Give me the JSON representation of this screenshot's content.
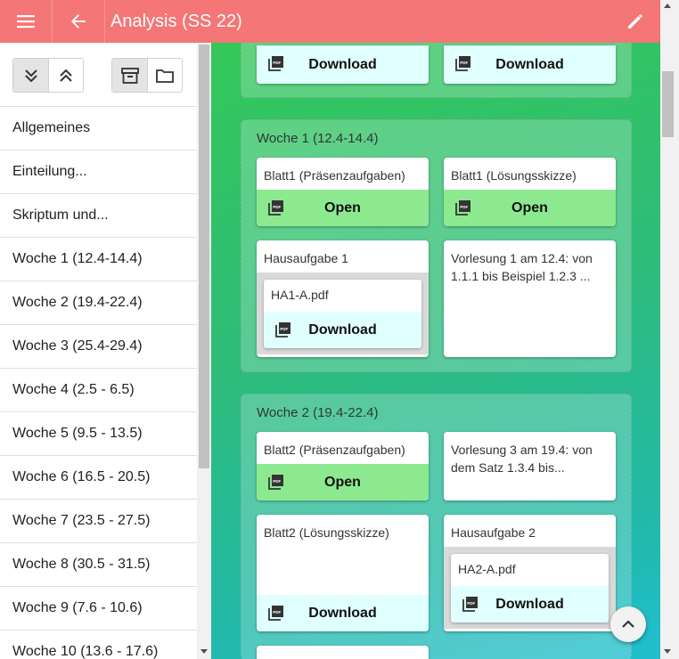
{
  "appbar": {
    "title": "Analysis (SS 22)",
    "menu_icon": "menu-icon",
    "back_icon": "arrow-back-icon",
    "edit_icon": "pencil-icon"
  },
  "sidebar": {
    "tools": {
      "collapse_all_icon": "chevron-double-down-icon",
      "expand_all_icon": "chevron-double-up-icon",
      "archive_icon": "archive-icon",
      "folder_icon": "folder-icon"
    },
    "items": [
      "Allgemeines",
      "Einteilung...",
      "Skriptum und...",
      "Woche 1 (12.4-14.4)",
      "Woche 2 (19.4-22.4)",
      "Woche 3 (25.4-29.4)",
      "Woche 4 (2.5 - 6.5)",
      "Woche 5 (9.5 - 13.5)",
      "Woche 6 (16.5 - 20.5)",
      "Woche 7 (23.5 - 27.5)",
      "Woche 8 (30.5 - 31.5)",
      "Woche 9 (7.6 - 10.6)",
      "Woche 10 (13.6 - 17.6)"
    ]
  },
  "main": {
    "top": {
      "download_left": "Download",
      "download_right": "Download"
    },
    "week1": {
      "title": "Woche 1 (12.4-14.4)",
      "card1": {
        "title": "Blatt1 (Präsenzaufgaben)",
        "action": "Open"
      },
      "card2": {
        "title": "Blatt1 (Lösungsskizze)",
        "action": "Open"
      },
      "card3": {
        "title": "Hausaufgabe 1",
        "file": "HA1-A.pdf",
        "action": "Download"
      },
      "card4": {
        "text": "Vorlesung 1 am 12.4: von 1.1.1 bis Beispiel 1.2.3 ..."
      }
    },
    "week2": {
      "title": "Woche 2 (19.4-22.4)",
      "card1": {
        "title": "Blatt2 (Präsenzaufgaben)",
        "action": "Open"
      },
      "card2": {
        "text": "Vorlesung 3 am 19.4: von dem Satz 1.3.4 bis..."
      },
      "card3": {
        "title": "Blatt2 (Lösungsskizze)",
        "action": "Download"
      },
      "card4": {
        "title": "Hausaufgabe 2",
        "file": "HA2-A.pdf",
        "action": "Download"
      }
    }
  },
  "fab_icon": "chevron-up-icon",
  "colors": {
    "appbar": "#f47676",
    "open": "#8de98f",
    "download": "#e0ffff"
  }
}
